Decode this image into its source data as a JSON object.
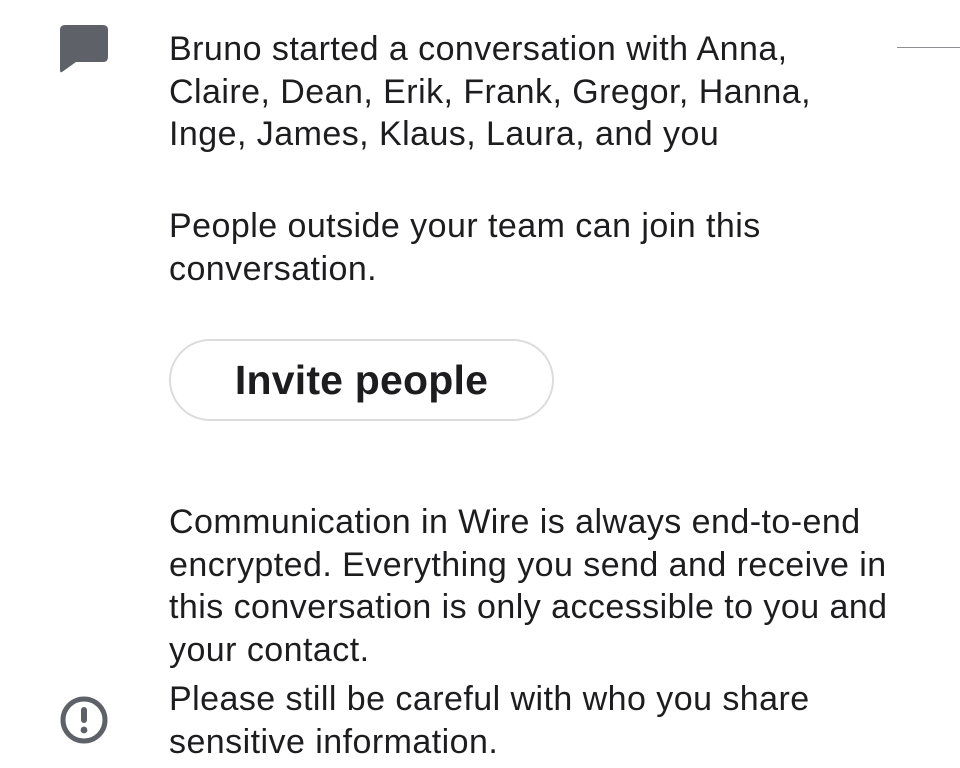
{
  "conversation": {
    "icon": "chat-bubble-icon",
    "started_text": "Bruno started a conversation with Anna, Claire, Dean, Erik, Frank, Gregor, Hanna, Inge, James, Klaus, Laura, and you",
    "guests_text": "People outside your team can join this conversation.",
    "invite_button_label": "Invite people"
  },
  "security_notice": {
    "icon": "exclamation-circle-icon",
    "encryption_text": "Communication in Wire is always end-to-end encrypted. Everything you send and receive in this conversation is only accessible to you and your contact.",
    "careful_text": "Please still be careful with who you share sensitive information."
  },
  "colors": {
    "icon_gray": "#5e6268",
    "text": "#1d1d1f",
    "button_border": "#dcdcde",
    "divider": "#8e8e93"
  }
}
